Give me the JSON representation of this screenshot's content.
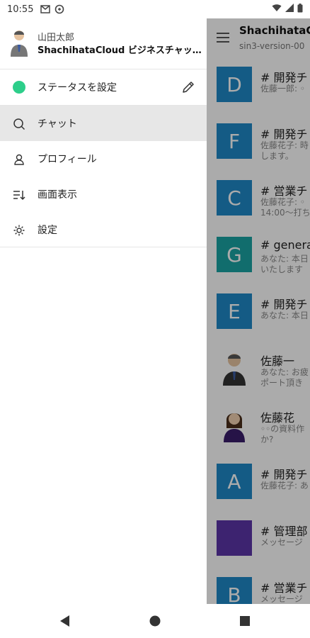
{
  "status_bar": {
    "time": "10:55"
  },
  "drawer": {
    "user_name": "山田太郎",
    "app_name": "ShachihataCloud ビジネスチャッ…",
    "status_label": "ステータスを設定",
    "status_color": "#2dce8a",
    "items": [
      {
        "label": "チャット",
        "icon": "search-icon"
      },
      {
        "label": "プロフィール",
        "icon": "person-icon"
      },
      {
        "label": "画面表示",
        "icon": "sort-icon"
      },
      {
        "label": "設定",
        "icon": "gear-icon"
      }
    ]
  },
  "background": {
    "title": "ShachihataCl",
    "subtitle": "sin3-version-00",
    "chats": [
      {
        "avatar": "D",
        "color": "#1e88c7",
        "name": "# 開発チ",
        "msg": "佐藤一郎: ◦"
      },
      {
        "avatar": "F",
        "color": "#1e88c7",
        "name": "# 開発チ",
        "msg": "佐藤花子: 時\nします。"
      },
      {
        "avatar": "C",
        "color": "#1e88c7",
        "name": "# 営業チ",
        "msg": "佐藤花子: ◦\n14:00〜打ち"
      },
      {
        "avatar": "G",
        "color": "#1aa3a3",
        "name": "# genera",
        "msg": "あなた: 本日\nいたします"
      },
      {
        "avatar": "E",
        "color": "#1e88c7",
        "name": "# 開発チ",
        "msg": "あなた: 本日"
      },
      {
        "avatar": "",
        "color": "",
        "name": "佐藤一",
        "msg": "あなた: お疲\nポート頂き"
      },
      {
        "avatar": "",
        "color": "",
        "name": "佐藤花",
        "msg": "◦◦の資料作\nか?"
      },
      {
        "avatar": "A",
        "color": "#1e88c7",
        "name": "# 開発チ",
        "msg": "佐藤花子: あ"
      },
      {
        "avatar": "",
        "color": "#5b35a8",
        "name": "# 管理部",
        "msg": "メッセージ"
      },
      {
        "avatar": "B",
        "color": "#1e88c7",
        "name": "# 営業チ",
        "msg": "メッセージ"
      }
    ]
  }
}
